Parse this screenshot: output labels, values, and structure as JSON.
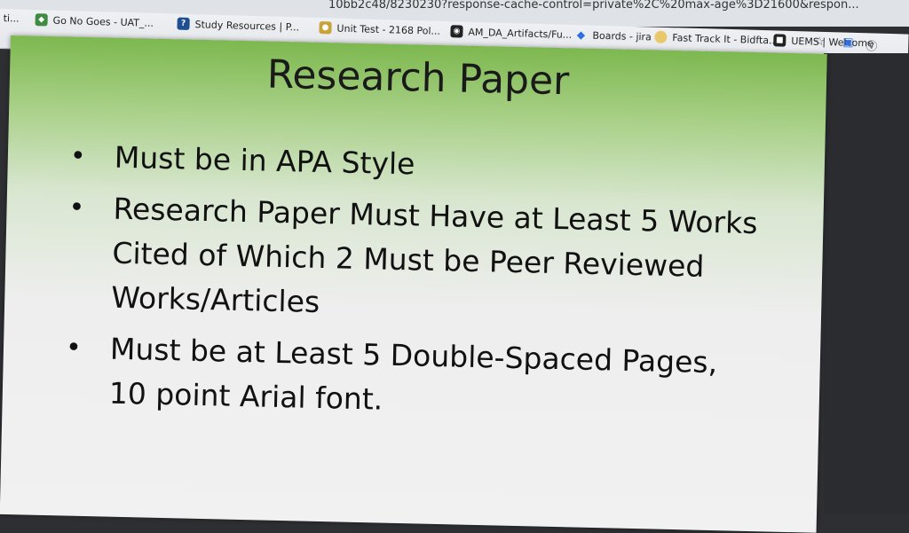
{
  "browser": {
    "url_fragment": "10bb2c48/8230230?response-cache-control=private%2C%20max-age%3D21600&respon...",
    "bookmarks": [
      {
        "label": "ti...",
        "icon": "tab-icon"
      },
      {
        "label": "Go No Goes - UAT_...",
        "icon": "bookmark-icon"
      },
      {
        "label": "Study Resources | P...",
        "icon": "question-icon"
      },
      {
        "label": "Unit Test - 2168 Pol...",
        "icon": "avatar-icon"
      },
      {
        "label": "AM_DA_Artifacts/Fu...",
        "icon": "github-icon"
      },
      {
        "label": "Boards - jira",
        "icon": "jira-icon"
      },
      {
        "label": "Fast Track It - Bidfta...",
        "icon": "circle-icon"
      },
      {
        "label": "UEMS | Welcome",
        "icon": "square-icon"
      }
    ]
  },
  "slide": {
    "title": "Research Paper",
    "bullets": [
      "Must be in APA Style",
      "Research Paper Must Have at Least 5 Works Cited of Which 2 Must be Peer Reviewed Works/Articles",
      "Must be at Least 5 Double-Spaced Pages, 10 point Arial font."
    ]
  },
  "colors": {
    "slide_top_green": "#7db84f",
    "slide_body": "#eeeeee",
    "bezel": "#2b2c30"
  }
}
